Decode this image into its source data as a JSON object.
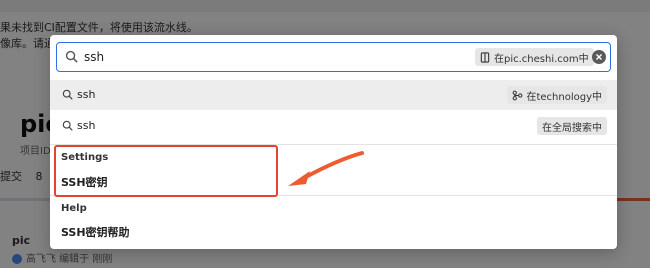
{
  "background": {
    "notice_line1": "果未找到CI配置文件，将使用该流水线。",
    "notice_line2": "像库。请通",
    "project_title": "pic.",
    "project_id": "项目ID",
    "nav_items": [
      "提交",
      "8"
    ],
    "commit_author": "pic",
    "commit_meta": "高飞飞 编辑于 刚刚"
  },
  "search": {
    "query": "ssh",
    "scope_chip": "在pic.cheshi.com中"
  },
  "suggestions": [
    {
      "text": "ssh",
      "scope": "在technology中",
      "active": true
    },
    {
      "text": "ssh",
      "scope": "在全局搜索中",
      "active": false
    }
  ],
  "sections": [
    {
      "heading": "Settings",
      "items": [
        "SSH密钥"
      ]
    },
    {
      "heading": "Help",
      "items": [
        "SSH密钥帮助"
      ]
    }
  ],
  "colors": {
    "accent_blue": "#2f6fe4",
    "annotation_red": "#e0452f",
    "annotation_arrow": "#f05a30"
  }
}
